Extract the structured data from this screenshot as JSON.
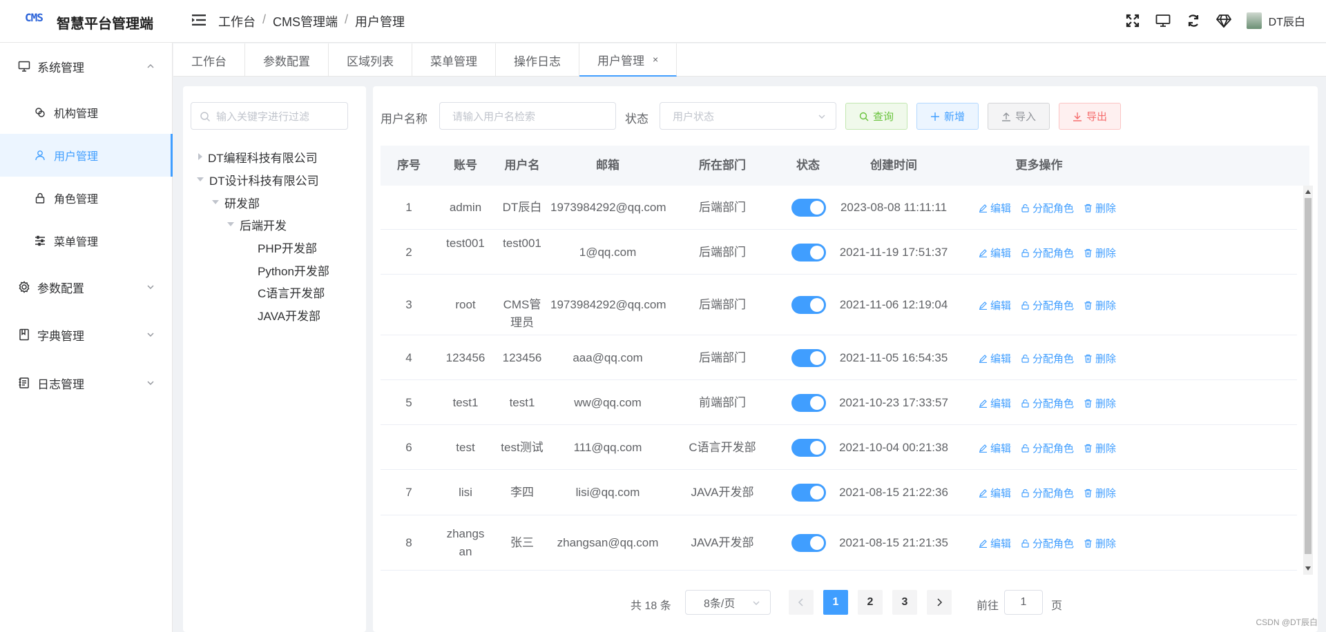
{
  "header": {
    "logo": "CMS",
    "app_title": "智慧平台管理端",
    "breadcrumb": [
      "工作台",
      "CMS管理端",
      "用户管理"
    ],
    "user_name": "DT辰白"
  },
  "sidebar": {
    "groups": [
      {
        "label": "系统管理",
        "icon": "monitor-icon",
        "expanded": true
      },
      {
        "label": "参数配置",
        "icon": "gear-icon",
        "expanded": false
      },
      {
        "label": "字典管理",
        "icon": "book-icon",
        "expanded": false
      },
      {
        "label": "日志管理",
        "icon": "log-icon",
        "expanded": false
      }
    ],
    "items": [
      {
        "label": "机构管理",
        "icon": "org-icon"
      },
      {
        "label": "用户管理",
        "icon": "user-icon",
        "active": true
      },
      {
        "label": "角色管理",
        "icon": "lock-icon"
      },
      {
        "label": "菜单管理",
        "icon": "sliders-icon"
      }
    ]
  },
  "tabs": [
    {
      "label": "工作台"
    },
    {
      "label": "参数配置"
    },
    {
      "label": "区域列表"
    },
    {
      "label": "菜单管理"
    },
    {
      "label": "操作日志"
    },
    {
      "label": "用户管理",
      "active": true,
      "close": "×"
    }
  ],
  "tree": {
    "placeholder": "输入关键字进行过滤",
    "nodes": [
      {
        "label": "DT编程科技有限公司",
        "level": 0,
        "state": "collapsed"
      },
      {
        "label": "DT设计科技有限公司",
        "level": 0,
        "state": "expanded"
      },
      {
        "label": "研发部",
        "level": 1,
        "state": "expanded"
      },
      {
        "label": "后端开发",
        "level": 2,
        "state": "expanded"
      },
      {
        "label": "PHP开发部",
        "level": 3,
        "state": "leaf"
      },
      {
        "label": "Python开发部",
        "level": 3,
        "state": "leaf"
      },
      {
        "label": "C语言开发部",
        "level": 3,
        "state": "leaf"
      },
      {
        "label": "JAVA开发部",
        "level": 3,
        "state": "leaf"
      }
    ]
  },
  "filters": {
    "username_label": "用户名称",
    "username_placeholder": "请输入用户名检索",
    "status_label": "状态",
    "status_placeholder": "用户状态",
    "query": "查询",
    "add": "新增",
    "import": "导入",
    "export": "导出"
  },
  "table": {
    "columns": [
      "序号",
      "账号",
      "用户名",
      "邮箱",
      "所在部门",
      "状态",
      "创建时间",
      "更多操作"
    ],
    "ops": {
      "edit": "编辑",
      "assign_role": "分配角色",
      "delete": "删除"
    },
    "rows": [
      {
        "no": "1",
        "account": "admin",
        "name": "DT辰白",
        "email": "1973984292@qq.com",
        "dept": "后端部门",
        "enabled": true,
        "created": "2023-08-08 11:11:11"
      },
      {
        "no": "2",
        "account": "test001",
        "name": "test001",
        "email": "1@qq.com",
        "dept": "后端部门",
        "enabled": true,
        "created": "2021-11-19 17:51:37"
      },
      {
        "no": "3",
        "account": "root",
        "name": "CMS管理员",
        "email": "1973984292@qq.com",
        "dept": "后端部门",
        "enabled": true,
        "created": "2021-11-06 12:19:04"
      },
      {
        "no": "4",
        "account": "123456",
        "name": "123456",
        "email": "aaa@qq.com",
        "dept": "后端部门",
        "enabled": true,
        "created": "2021-11-05 16:54:35"
      },
      {
        "no": "5",
        "account": "test1",
        "name": "test1",
        "email": "ww@qq.com",
        "dept": "前端部门",
        "enabled": true,
        "created": "2021-10-23 17:33:57"
      },
      {
        "no": "6",
        "account": "test",
        "name": "test测试",
        "email": "111@qq.com",
        "dept": "C语言开发部",
        "enabled": true,
        "created": "2021-10-04 00:21:38"
      },
      {
        "no": "7",
        "account": "lisi",
        "name": "李四",
        "email": "lisi@qq.com",
        "dept": "JAVA开发部",
        "enabled": true,
        "created": "2021-08-15 21:22:36"
      },
      {
        "no": "8",
        "account": "zhangsan",
        "name": "张三",
        "email": "zhangsan@qq.com",
        "dept": "JAVA开发部",
        "enabled": true,
        "created": "2021-08-15 21:21:35"
      }
    ]
  },
  "pagination": {
    "total": "共 18 条",
    "page_size": "8条/页",
    "pages": [
      "1",
      "2",
      "3"
    ],
    "current": "1",
    "goto_label": "前往",
    "goto_value": "1",
    "goto_unit": "页"
  },
  "watermark": "CSDN @DT辰白",
  "colors": {
    "primary": "#409eff",
    "success": "#67c23a",
    "danger": "#f56c6c",
    "info": "#909399"
  }
}
